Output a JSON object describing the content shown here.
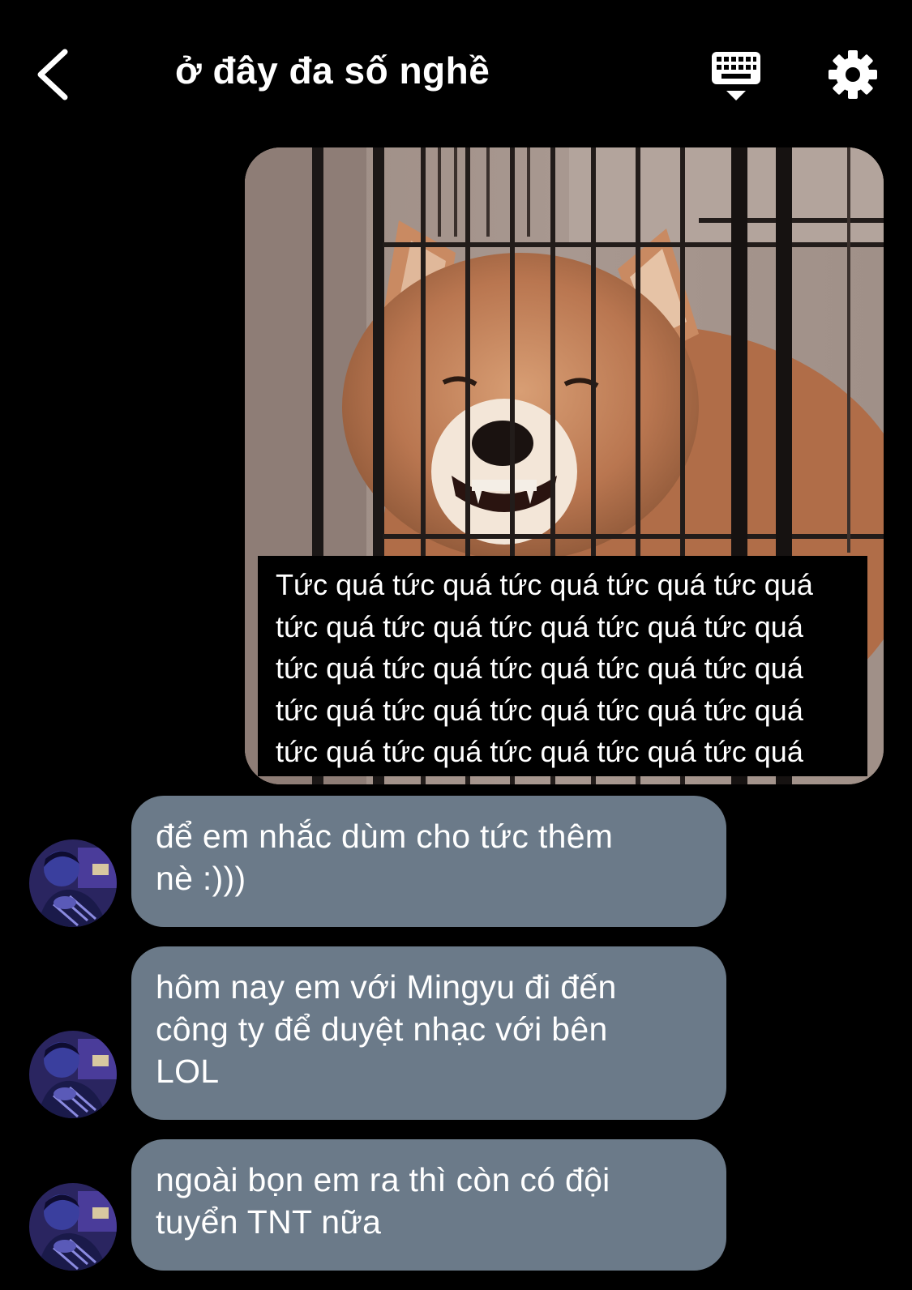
{
  "header": {
    "title": "ở đây đa số nghề",
    "back_icon": "chevron-left-icon",
    "keyboard_icon": "keyboard-icon",
    "settings_icon": "gear-icon"
  },
  "image_message": {
    "caption_lines": [
      "Tức quá tức quá tức quá tức quá tức quá",
      "tức quá tức quá tức quá tức quá tức quá",
      "tức quá tức quá tức quá tức quá tức quá",
      "tức quá tức quá tức quá tức quá tức quá",
      "tức quá tức quá tức quá tức quá tức quá"
    ]
  },
  "messages": [
    {
      "text_lines": [
        "để em nhắc dùm cho tức thêm",
        "nè :)))"
      ]
    },
    {
      "text_lines": [
        "hôm nay em với Mingyu đi đến",
        "công ty để duyệt nhạc với bên",
        "LOL"
      ]
    },
    {
      "text_lines": [
        "ngoài bọn em ra thì còn có đội",
        "tuyển TNT nữa"
      ]
    }
  ],
  "colors": {
    "background": "#000000",
    "bubble": "#6b7a89",
    "text": "#ffffff"
  }
}
